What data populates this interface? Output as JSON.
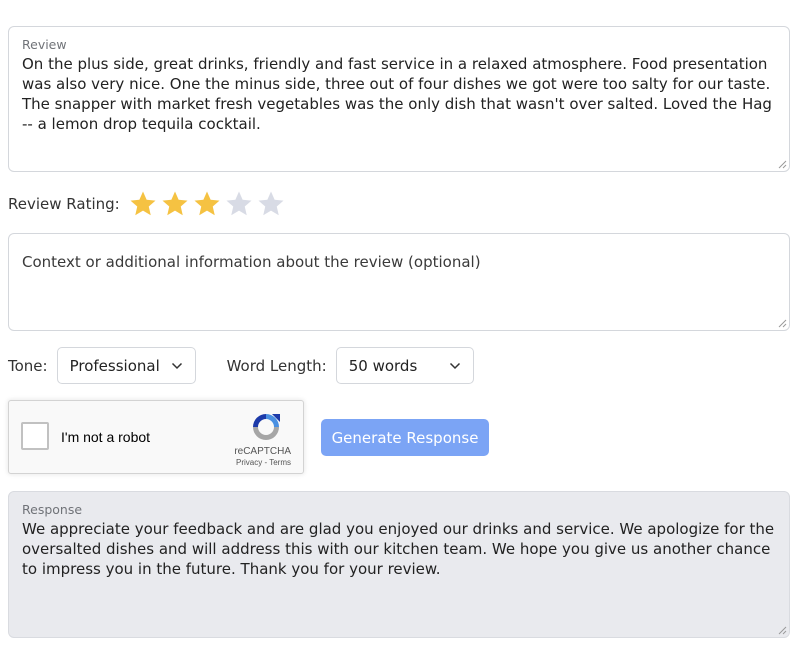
{
  "review": {
    "label": "Review",
    "text": "On the plus side, great drinks, friendly and fast service in a relaxed atmosphere. Food presentation was also very nice. One the minus side, three out of four dishes we got were too salty for our taste. The snapper with market fresh vegetables was the only dish that wasn't over salted. Loved the Hag -- a lemon drop tequila cocktail."
  },
  "rating": {
    "label": "Review Rating:",
    "value": 3,
    "max": 5,
    "filled_color": "#f5c242",
    "empty_color": "#d8dbe5"
  },
  "context": {
    "placeholder": "Context or additional information about the review (optional)"
  },
  "tone": {
    "label": "Tone:",
    "selected": "Professional"
  },
  "word_length": {
    "label": "Word Length:",
    "selected": "50 words"
  },
  "recaptcha": {
    "checkbox_label": "I'm not a robot",
    "brand": "reCAPTCHA",
    "links": "Privacy - Terms",
    "icon": "recaptcha-logo"
  },
  "generate_button": {
    "label": "Generate Response",
    "color": "#7ba4f5"
  },
  "response": {
    "label": "Response",
    "text": "We appreciate your feedback and are glad you enjoyed our drinks and service. We apologize for the oversalted dishes and will address this with our kitchen team. We hope you give us another chance to impress you in the future. Thank you for your review."
  }
}
